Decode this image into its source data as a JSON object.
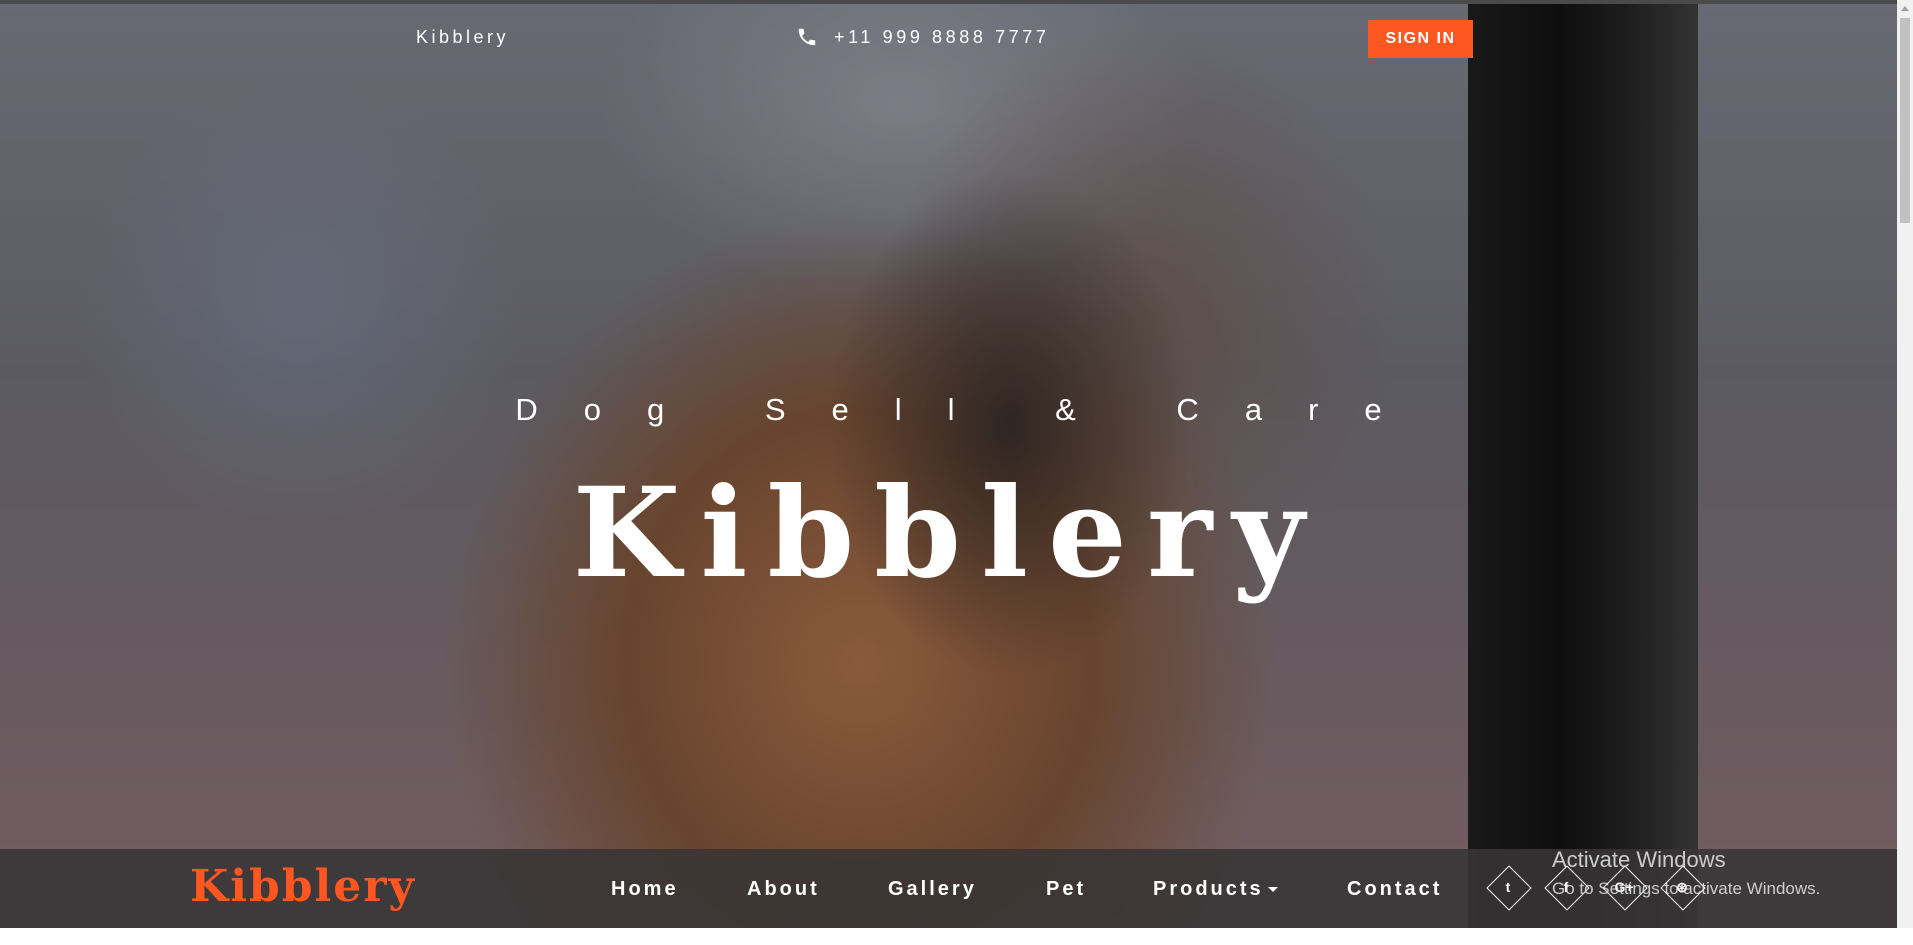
{
  "header": {
    "brand": "Kibblery",
    "phone": "+11 999 8888 7777",
    "phone_icon": "phone-icon",
    "signin_label": "SIGN IN",
    "accent_color": "#ff5722"
  },
  "hero": {
    "tagline": "Dog Sell & Care",
    "title": "Kibblery"
  },
  "navbar": {
    "logo": "Kibblery",
    "items": [
      {
        "label": "Home"
      },
      {
        "label": "About"
      },
      {
        "label": "Gallery"
      },
      {
        "label": "Pet"
      },
      {
        "label": "Products",
        "has_dropdown": true
      },
      {
        "label": "Contact"
      }
    ],
    "social": [
      {
        "icon": "twitter-icon",
        "glyph": "t"
      },
      {
        "icon": "facebook-icon",
        "glyph": "f"
      },
      {
        "icon": "google-plus-icon",
        "glyph": "G+"
      },
      {
        "icon": "dribbble-icon",
        "glyph": "⊛"
      }
    ]
  },
  "windows_watermark": {
    "line1": "Activate Windows",
    "line2": "Go to Settings to activate Windows."
  }
}
